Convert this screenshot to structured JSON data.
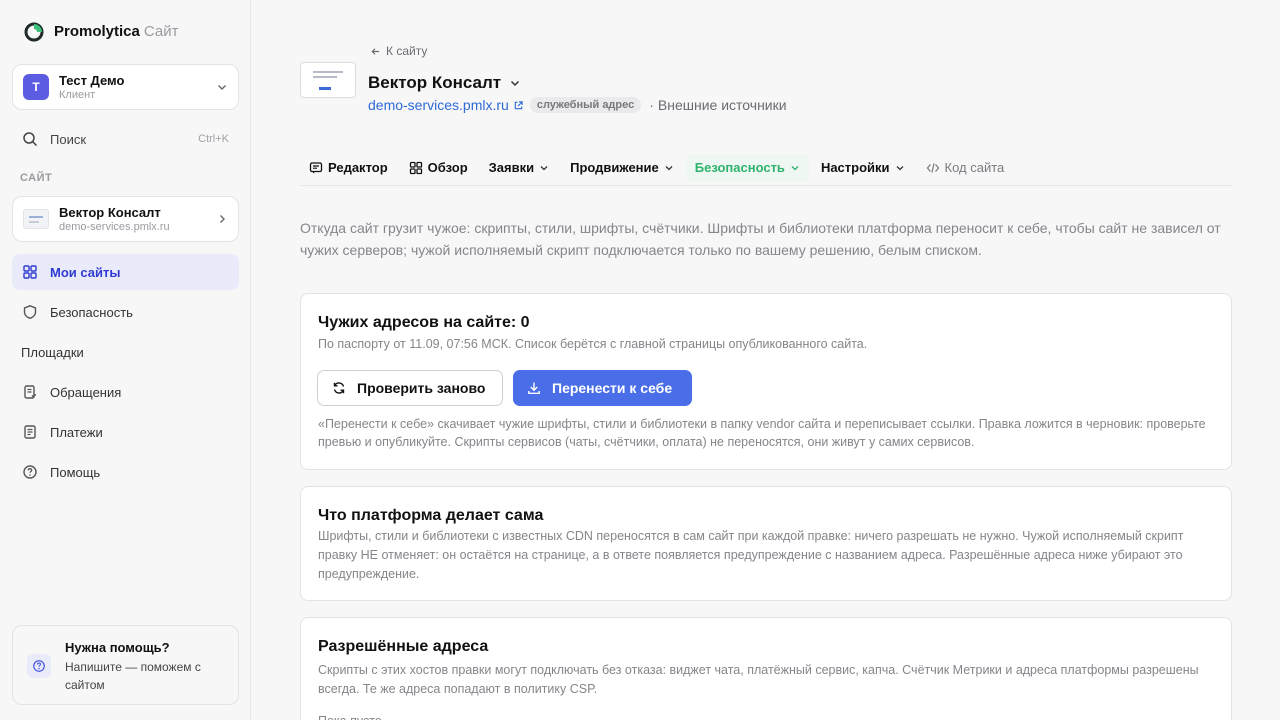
{
  "brand": {
    "name": "Promolytica",
    "suffix": "Сайт"
  },
  "account": {
    "initial": "T",
    "name": "Тест Демо",
    "role": "Клиент"
  },
  "search": {
    "label": "Поиск",
    "shortcut": "Ctrl+K"
  },
  "sidebar": {
    "section_label": "САЙТ",
    "site": {
      "name": "Вектор Консалт",
      "domain": "demo-services.pmlx.ru"
    },
    "items": [
      {
        "label": "Мои сайты",
        "icon": "grid-icon"
      },
      {
        "label": "Безопасность",
        "icon": "shield-icon"
      },
      {
        "label": "Площадки",
        "icon": ""
      },
      {
        "label": "Обращения",
        "icon": "form-icon"
      },
      {
        "label": "Платежи",
        "icon": "receipt-icon"
      },
      {
        "label": "Помощь",
        "icon": "help-icon"
      }
    ],
    "help": {
      "title": "Нужна помощь?",
      "text": "Напишите — поможем с сайтом"
    }
  },
  "header": {
    "back_label": "К сайту",
    "site_name": "Вектор Консалт",
    "site_domain": "demo-services.pmlx.ru",
    "badge": "служебный адрес",
    "external_sources": "Внешние источники"
  },
  "tabs": [
    {
      "label": "Редактор",
      "icon": "editor-icon"
    },
    {
      "label": "Обзор",
      "icon": "overview-icon"
    },
    {
      "label": "Заявки"
    },
    {
      "label": "Продвижение"
    },
    {
      "label": "Безопасность",
      "active": true
    },
    {
      "label": "Настройки"
    },
    {
      "label": "Код сайта",
      "icon": "code-icon"
    }
  ],
  "intro": "Откуда сайт грузит чужое: скрипты, стили, шрифты, счётчики. Шрифты и библиотеки платформа переносит к себе, чтобы сайт не зависел от чужих серверов; чужой исполняемый скрипт подключается только по вашему решению, белым списком.",
  "card_foreign": {
    "title": "Чужих адресов на сайте: 0",
    "subtitle": "По паспорту от 11.09, 07:56 МСК. Список берётся с главной страницы опубликованного сайта.",
    "recheck_label": "Проверить заново",
    "transfer_label": "Перенести к себе",
    "note": "«Перенести к себе» скачивает чужие шрифты, стили и библиотеки в папку vendor сайта и переписывает ссылки. Правка ложится в черновик: проверьте превью и опубликуйте. Скрипты сервисов (чаты, счётчики, оплата) не переносятся, они живут у самих сервисов."
  },
  "card_platform": {
    "title": "Что платформа делает сама",
    "text": "Шрифты, стили и библиотеки с известных CDN переносятся в сам сайт при каждой правке: ничего разрешать не нужно. Чужой исполняемый скрипт правку НЕ отменяет: он остаётся на странице, а в ответе появляется предупреждение с названием адреса. Разрешённые адреса ниже убирают это предупреждение."
  },
  "card_allowed": {
    "title": "Разрешённые адреса",
    "text": "Скрипты с этих хостов правки могут подключать без отказа: виджет чата, платёжный сервис, капча. Счётчик Метрики и адреса платформы разрешены всегда. Те же адреса попадают в политику CSP.",
    "empty": "Пока пусто."
  },
  "colors": {
    "accent": "#4a6ee8",
    "active_tab": "#2fb36e",
    "nav_active": "#2f3bd0"
  }
}
